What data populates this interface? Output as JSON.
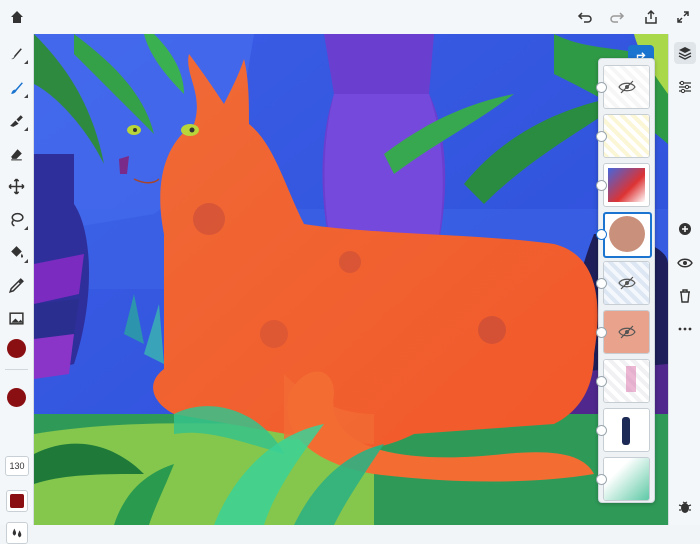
{
  "toolbar": {
    "icons": [
      "home-icon",
      "undo-icon",
      "redo-icon",
      "share-icon",
      "fullscreen-icon"
    ]
  },
  "left_tools": [
    "brush-tool-icon",
    "paint-brush-icon",
    "smudge-tool-icon",
    "eraser-icon",
    "move-icon",
    "lasso-icon",
    "fill-bucket-icon",
    "eyedropper-icon",
    "image-icon"
  ],
  "brush": {
    "size": "130",
    "color": "#8a0f12"
  },
  "layers_panel": {
    "layers": [
      {
        "name": "layer-1",
        "hidden": true
      },
      {
        "name": "layer-2",
        "hidden": false
      },
      {
        "name": "layer-3",
        "hidden": false
      },
      {
        "name": "layer-4",
        "hidden": false,
        "active": true
      },
      {
        "name": "layer-5",
        "hidden": true
      },
      {
        "name": "layer-6",
        "hidden": true
      },
      {
        "name": "layer-7",
        "hidden": false
      },
      {
        "name": "layer-8",
        "hidden": false
      },
      {
        "name": "layer-9",
        "hidden": false
      }
    ]
  },
  "right_tools": [
    "layers-icon",
    "adjustments-icon",
    "add-layer-icon",
    "visibility-icon",
    "delete-icon",
    "more-icon",
    "bug-icon"
  ],
  "colors": {
    "accent": "#1b74d0",
    "cat": "#f3632a",
    "background_blue": "#3f5fe0"
  }
}
